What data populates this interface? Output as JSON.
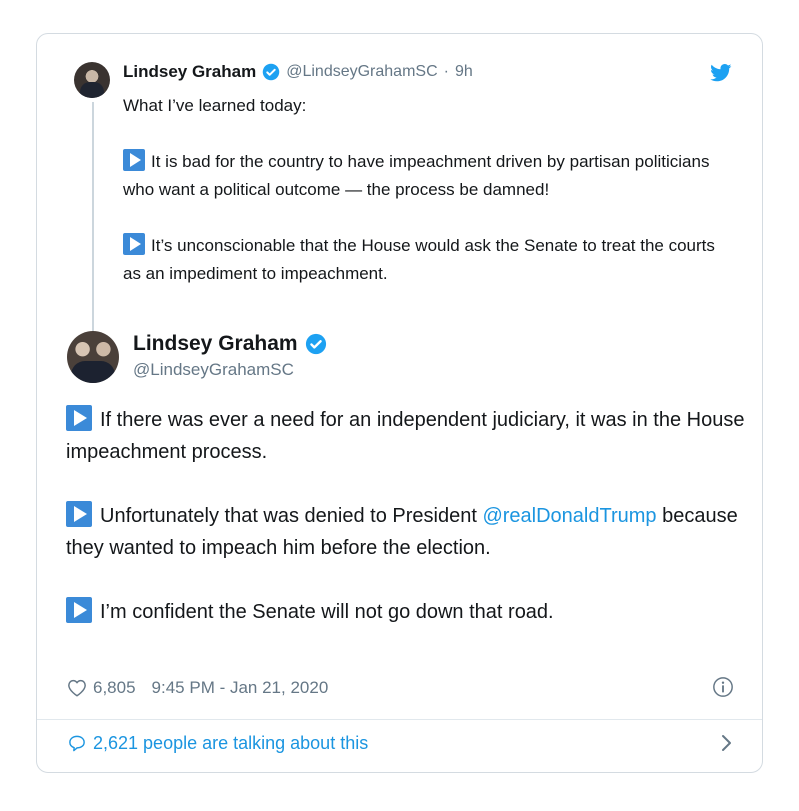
{
  "parent_tweet": {
    "author_name": "Lindsey Graham",
    "handle": "@LindseyGrahamSC",
    "separator": "·",
    "time": "9h",
    "intro": "What I’ve learned today:",
    "points": [
      "It is bad for the country to have impeachment driven by partisan politicians who want a political outcome  — the process be damned!",
      "It’s unconscionable that the House would ask the Senate to treat the courts as an impediment to impeachment."
    ]
  },
  "main_tweet": {
    "author_name": "Lindsey Graham",
    "handle": "@LindseyGrahamSC",
    "point1": "If there was ever a need for an independent judiciary, it was in the House impeachment process.",
    "point2_before": "Unfortunately that was denied to President ",
    "point2_mention": "@realDonaldTrump",
    "point2_after": " because they wanted to impeach him before the election.",
    "point3": "I’m confident the Senate will not go down that road.",
    "likes": "6,805",
    "timestamp": "9:45 PM - Jan 21, 2020"
  },
  "conversation": {
    "label": "2,621 people are talking about this"
  },
  "colors": {
    "accent": "#1b95e0",
    "verified": "#1da1f2",
    "arrow_emoji": "#3b8ad8",
    "muted": "#657786",
    "border": "#d4dbe1"
  },
  "icons": [
    "verified-badge-icon",
    "twitter-bird-icon",
    "heart-icon",
    "info-icon",
    "speech-bubble-icon",
    "chevron-right-icon",
    "play-arrow-emoji-icon"
  ]
}
